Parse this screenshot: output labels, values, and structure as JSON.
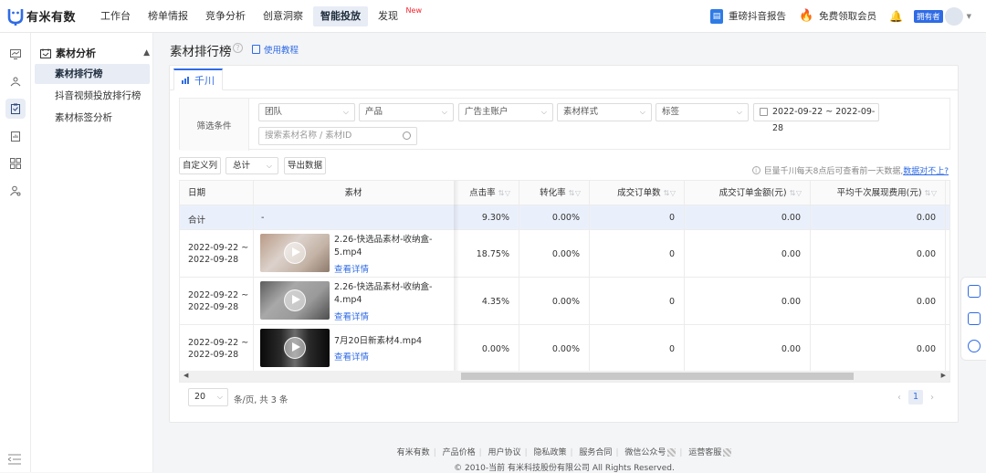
{
  "brand": {
    "name": "有米有数"
  },
  "nav": {
    "items": [
      {
        "label": "工作台"
      },
      {
        "label": "榜单情报"
      },
      {
        "label": "竞争分析"
      },
      {
        "label": "创意洞察"
      },
      {
        "label": "智能投放"
      },
      {
        "label": "发现"
      }
    ],
    "new_badge": "New",
    "report_label": "重磅抖音报告",
    "vip_label": "免费领取会员",
    "owner_badge": "拥有者"
  },
  "rail_icons": [
    "trend-icon",
    "tag-user-icon",
    "clipboard-icon",
    "report-icon",
    "grid-icon",
    "user-settings-icon"
  ],
  "submenu": {
    "header": "素材分析",
    "items": [
      {
        "label": "素材排行榜"
      },
      {
        "label": "抖音视频投放排行榜"
      },
      {
        "label": "素材标签分析"
      }
    ]
  },
  "page": {
    "title": "素材排行榜",
    "tutorial_label": "使用教程",
    "tab_label": "千川"
  },
  "filters": {
    "label": "筛选条件",
    "team": "团队",
    "product": "产品",
    "account": "广告主账户",
    "style": "素材样式",
    "tag": "标签",
    "date_range": "2022-09-22 ~ 2022-09-28",
    "search_placeholder": "搜索素材名称 / 素材ID"
  },
  "toolbar": {
    "custom_columns": "自定义列",
    "total_select": "总计",
    "export": "导出数据",
    "notice": "巨量千川每天8点后可查看前一天数据,",
    "notice_link": "数据对不上?"
  },
  "table": {
    "columns": {
      "date": "日期",
      "material": "素材",
      "ctr": "点击率",
      "cvr": "转化率",
      "orders": "成交订单数",
      "amount": "成交订单金额(元)",
      "cpm": "平均千次展现费用(元)"
    },
    "total": {
      "label": "合计",
      "material": "-",
      "ctr": "9.30%",
      "cvr": "0.00%",
      "orders": "0",
      "amount": "0.00",
      "cpm": "0.00"
    },
    "rows": [
      {
        "date1": "2022-09-22 ~",
        "date2": "2022-09-28",
        "name": "2.26-快选品素材-收纳盒-5.mp4",
        "detail": "查看详情",
        "ctr": "18.75%",
        "cvr": "0.00%",
        "orders": "0",
        "amount": "0.00",
        "cpm": "0.00"
      },
      {
        "date1": "2022-09-22 ~",
        "date2": "2022-09-28",
        "name": "2.26-快选品素材-收纳盒-4.mp4",
        "detail": "查看详情",
        "ctr": "4.35%",
        "cvr": "0.00%",
        "orders": "0",
        "amount": "0.00",
        "cpm": "0.00"
      },
      {
        "date1": "2022-09-22 ~",
        "date2": "2022-09-28",
        "name": "7月20日新素材4.mp4",
        "detail": "查看详情",
        "ctr": "0.00%",
        "cvr": "0.00%",
        "orders": "0",
        "amount": "0.00",
        "cpm": "0.00"
      }
    ]
  },
  "pagination": {
    "page_size": "20",
    "summary": "条/页, 共 3 条",
    "current": "1"
  },
  "footer": {
    "links": [
      "有米有数",
      "产品价格",
      "用户协议",
      "隐私政策",
      "服务合同",
      "微信公众号",
      "运营客服"
    ],
    "copyright": "© 2010-当前 有米科技股份有限公司 All Rights Reserved."
  },
  "colors": {
    "accent": "#2f6be5",
    "active_bg": "#e7ecf5",
    "new_badge": "#f5222d",
    "fire": "#f5411b"
  }
}
